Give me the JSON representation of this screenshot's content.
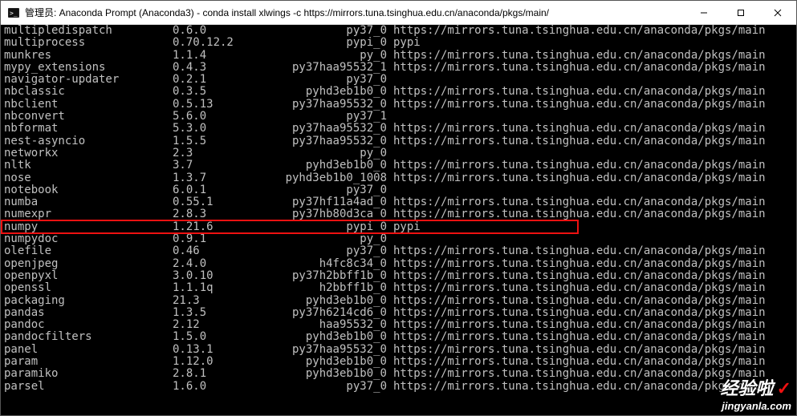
{
  "window": {
    "title": "管理员: Anaconda Prompt (Anaconda3) - conda  install xlwings -c https://mirrors.tuna.tsinghua.edu.cn/anaconda/pkgs/main/"
  },
  "packages": [
    {
      "name": "multipledispatch",
      "ver": "0.6.0",
      "build": "py37_0",
      "channel": "https://mirrors.tuna.tsinghua.edu.cn/anaconda/pkgs/main"
    },
    {
      "name": "multiprocess",
      "ver": "0.70.12.2",
      "build": "pypi_0",
      "channel": "pypi"
    },
    {
      "name": "munkres",
      "ver": "1.1.4",
      "build": "py_0",
      "channel": "https://mirrors.tuna.tsinghua.edu.cn/anaconda/pkgs/main"
    },
    {
      "name": "mypy_extensions",
      "ver": "0.4.3",
      "build": "py37haa95532_1",
      "channel": "https://mirrors.tuna.tsinghua.edu.cn/anaconda/pkgs/main"
    },
    {
      "name": "navigator-updater",
      "ver": "0.2.1",
      "build": "py37_0",
      "channel": ""
    },
    {
      "name": "nbclassic",
      "ver": "0.3.5",
      "build": "pyhd3eb1b0_0",
      "channel": "https://mirrors.tuna.tsinghua.edu.cn/anaconda/pkgs/main"
    },
    {
      "name": "nbclient",
      "ver": "0.5.13",
      "build": "py37haa95532_0",
      "channel": "https://mirrors.tuna.tsinghua.edu.cn/anaconda/pkgs/main"
    },
    {
      "name": "nbconvert",
      "ver": "5.6.0",
      "build": "py37_1",
      "channel": ""
    },
    {
      "name": "nbformat",
      "ver": "5.3.0",
      "build": "py37haa95532_0",
      "channel": "https://mirrors.tuna.tsinghua.edu.cn/anaconda/pkgs/main"
    },
    {
      "name": "nest-asyncio",
      "ver": "1.5.5",
      "build": "py37haa95532_0",
      "channel": "https://mirrors.tuna.tsinghua.edu.cn/anaconda/pkgs/main"
    },
    {
      "name": "networkx",
      "ver": "2.3",
      "build": "py_0",
      "channel": ""
    },
    {
      "name": "nltk",
      "ver": "3.7",
      "build": "pyhd3eb1b0_0",
      "channel": "https://mirrors.tuna.tsinghua.edu.cn/anaconda/pkgs/main"
    },
    {
      "name": "nose",
      "ver": "1.3.7",
      "build": "pyhd3eb1b0_1008",
      "channel": "https://mirrors.tuna.tsinghua.edu.cn/anaconda/pkgs/main"
    },
    {
      "name": "notebook",
      "ver": "6.0.1",
      "build": "py37_0",
      "channel": ""
    },
    {
      "name": "numba",
      "ver": "0.55.1",
      "build": "py37hf11a4ad_0",
      "channel": "https://mirrors.tuna.tsinghua.edu.cn/anaconda/pkgs/main"
    },
    {
      "name": "numexpr",
      "ver": "2.8.3",
      "build": "py37hb80d3ca_0",
      "channel": "https://mirrors.tuna.tsinghua.edu.cn/anaconda/pkgs/main"
    },
    {
      "name": "numpy",
      "ver": "1.21.6",
      "build": "pypi_0",
      "channel": "pypi"
    },
    {
      "name": "numpydoc",
      "ver": "0.9.1",
      "build": "py_0",
      "channel": ""
    },
    {
      "name": "olefile",
      "ver": "0.46",
      "build": "py37_0",
      "channel": "https://mirrors.tuna.tsinghua.edu.cn/anaconda/pkgs/main"
    },
    {
      "name": "openjpeg",
      "ver": "2.4.0",
      "build": "h4fc8c34_0",
      "channel": "https://mirrors.tuna.tsinghua.edu.cn/anaconda/pkgs/main"
    },
    {
      "name": "openpyxl",
      "ver": "3.0.10",
      "build": "py37h2bbff1b_0",
      "channel": "https://mirrors.tuna.tsinghua.edu.cn/anaconda/pkgs/main"
    },
    {
      "name": "openssl",
      "ver": "1.1.1q",
      "build": "h2bbff1b_0",
      "channel": "https://mirrors.tuna.tsinghua.edu.cn/anaconda/pkgs/main"
    },
    {
      "name": "packaging",
      "ver": "21.3",
      "build": "pyhd3eb1b0_0",
      "channel": "https://mirrors.tuna.tsinghua.edu.cn/anaconda/pkgs/main"
    },
    {
      "name": "pandas",
      "ver": "1.3.5",
      "build": "py37h6214cd6_0",
      "channel": "https://mirrors.tuna.tsinghua.edu.cn/anaconda/pkgs/main"
    },
    {
      "name": "pandoc",
      "ver": "2.12",
      "build": "haa95532_0",
      "channel": "https://mirrors.tuna.tsinghua.edu.cn/anaconda/pkgs/main"
    },
    {
      "name": "pandocfilters",
      "ver": "1.5.0",
      "build": "pyhd3eb1b0_0",
      "channel": "https://mirrors.tuna.tsinghua.edu.cn/anaconda/pkgs/main"
    },
    {
      "name": "panel",
      "ver": "0.13.1",
      "build": "py37haa95532_0",
      "channel": "https://mirrors.tuna.tsinghua.edu.cn/anaconda/pkgs/main"
    },
    {
      "name": "param",
      "ver": "1.12.0",
      "build": "pyhd3eb1b0_0",
      "channel": "https://mirrors.tuna.tsinghua.edu.cn/anaconda/pkgs/main"
    },
    {
      "name": "paramiko",
      "ver": "2.8.1",
      "build": "pyhd3eb1b0_0",
      "channel": "https://mirrors.tuna.tsinghua.edu.cn/anaconda/pkgs/main"
    },
    {
      "name": "parsel",
      "ver": "1.6.0",
      "build": "py37_0",
      "channel": "https://mirrors.tuna.tsinghua.edu.cn/anaconda/pkgs/main"
    }
  ],
  "highlight_row_index": 16,
  "watermark": {
    "line1": "经验啦",
    "line2": "jingyanla.com"
  }
}
